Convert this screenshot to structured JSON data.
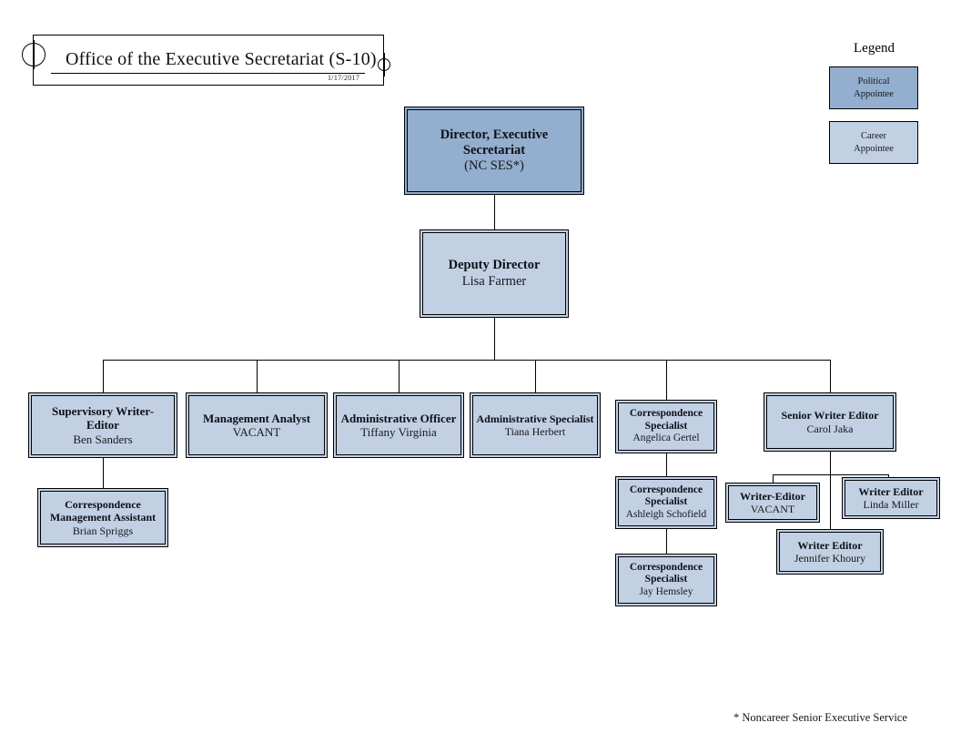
{
  "document": {
    "title": "Office of the Executive Secretariat (S-10)",
    "date": "1/17/2017",
    "footnote": "* Noncareer Senior Executive Service"
  },
  "legend": {
    "heading": "Legend",
    "items": [
      {
        "label_line1": "Political",
        "label_line2": "Appointee",
        "color": "#93aece",
        "type": "political"
      },
      {
        "label_line1": "Career",
        "label_line2": "Appointee",
        "color": "#c2d0e4",
        "type": "career"
      }
    ]
  },
  "colors": {
    "political_appointee": "#93aece",
    "career_appointee": "#c2d0e4",
    "border": "#000000",
    "background": "#ffffff"
  },
  "org": {
    "director": {
      "title_line1": "Director, Executive",
      "title_line2": "Secretariat",
      "name": "(NC SES*)",
      "appointee_type": "political"
    },
    "deputy_director": {
      "title": "Deputy Director",
      "name": "Lisa Farmer",
      "appointee_type": "career"
    },
    "divisions": [
      {
        "title_line1": "Supervisory Writer-",
        "title_line2": "Editor",
        "name": "Ben Sanders",
        "appointee_type": "career"
      },
      {
        "title": "Management Analyst",
        "name": "VACANT",
        "appointee_type": "career"
      },
      {
        "title": "Administrative Officer",
        "name": "Tiffany Virginia",
        "appointee_type": "career"
      },
      {
        "title": "Administrative Specialist",
        "name": "Tiana Herbert",
        "appointee_type": "career"
      },
      {
        "title_line1": "Correspondence",
        "title_line2": "Specialist",
        "name": "Angelica Gertel",
        "appointee_type": "career"
      },
      {
        "title": "Senior Writer Editor",
        "name": "Carol Jaka",
        "appointee_type": "career"
      }
    ],
    "sub_supervisory_writer_editor": {
      "title_line1": "Correspondence",
      "title_line2": "Management Assistant",
      "name": "Brian Spriggs",
      "appointee_type": "career"
    },
    "correspondence_chain": [
      {
        "title_line1": "Correspondence",
        "title_line2": "Specialist",
        "name": "Ashleigh Schofield",
        "appointee_type": "career"
      },
      {
        "title_line1": "Correspondence",
        "title_line2": "Specialist",
        "name": "Jay Hemsley",
        "appointee_type": "career"
      }
    ],
    "writer_editors": [
      {
        "title": "Writer-Editor",
        "name": "VACANT",
        "appointee_type": "career"
      },
      {
        "title": "Writer Editor",
        "name": "Linda Miller",
        "appointee_type": "career"
      },
      {
        "title": "Writer Editor",
        "name": "Jennifer Khoury",
        "appointee_type": "career"
      }
    ]
  }
}
